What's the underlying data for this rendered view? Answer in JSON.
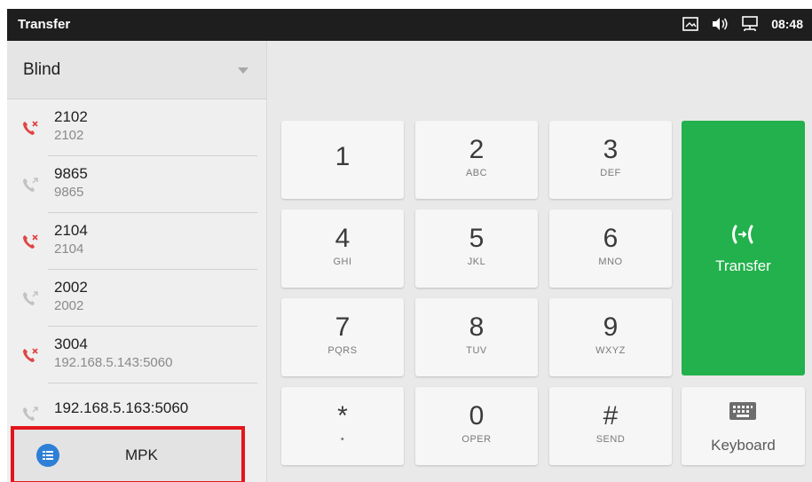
{
  "statusbar": {
    "title": "Transfer",
    "time": "08:48"
  },
  "transfer_mode": {
    "selected": "Blind"
  },
  "calls": [
    {
      "number": "2102",
      "detail": "2102",
      "type": "missed"
    },
    {
      "number": "9865",
      "detail": "9865",
      "type": "outgoing"
    },
    {
      "number": "2104",
      "detail": "2104",
      "type": "missed"
    },
    {
      "number": "2002",
      "detail": "2002",
      "type": "outgoing"
    },
    {
      "number": "3004",
      "detail": "192.168.5.143:5060",
      "type": "missed"
    },
    {
      "number": "192.168.5.163:5060",
      "detail": "",
      "type": "outgoing"
    }
  ],
  "mpk": {
    "label": "MPK"
  },
  "keypad": [
    {
      "digit": "1",
      "letters": ""
    },
    {
      "digit": "2",
      "letters": "ABC"
    },
    {
      "digit": "3",
      "letters": "DEF"
    },
    {
      "digit": "4",
      "letters": "GHI"
    },
    {
      "digit": "5",
      "letters": "JKL"
    },
    {
      "digit": "6",
      "letters": "MNO"
    },
    {
      "digit": "7",
      "letters": "PQRS"
    },
    {
      "digit": "8",
      "letters": "TUV"
    },
    {
      "digit": "9",
      "letters": "WXYZ"
    },
    {
      "digit": "*",
      "letters": "•"
    },
    {
      "digit": "0",
      "letters": "OPER"
    },
    {
      "digit": "#",
      "letters": "SEND"
    }
  ],
  "transfer_button": {
    "label": "Transfer"
  },
  "keyboard_button": {
    "label": "Keyboard"
  },
  "colors": {
    "accent_green": "#22b14c",
    "missed_red": "#e04545",
    "mpk_blue": "#2e7fd6",
    "highlight_red": "#e3161b"
  }
}
